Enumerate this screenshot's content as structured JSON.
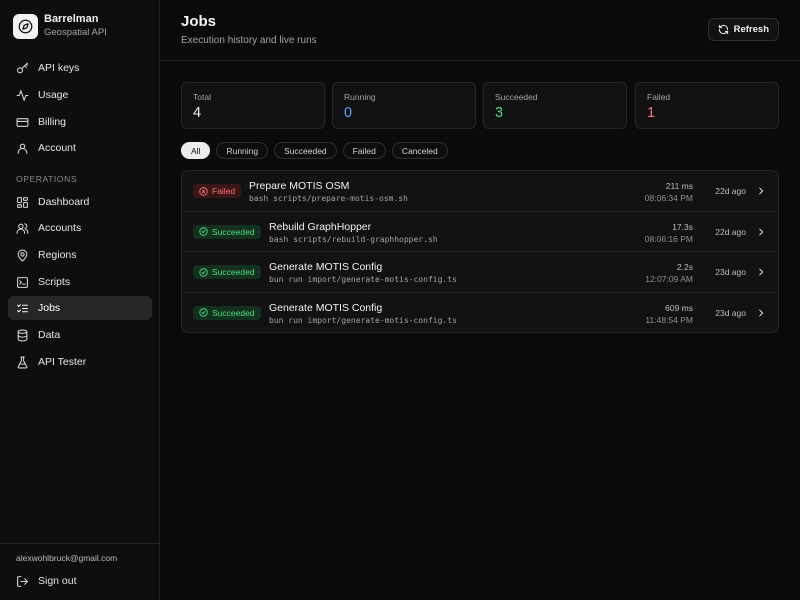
{
  "brand": {
    "name": "Barrelman",
    "subtitle": "Geospatial API",
    "logo_icon": "compass-icon"
  },
  "nav_top": [
    {
      "label": "API keys",
      "icon": "key-icon"
    },
    {
      "label": "Usage",
      "icon": "activity-icon"
    },
    {
      "label": "Billing",
      "icon": "credit-card-icon"
    },
    {
      "label": "Account",
      "icon": "user-icon"
    }
  ],
  "section_label": "OPERATIONS",
  "nav_ops": [
    {
      "label": "Dashboard",
      "icon": "dashboard-icon"
    },
    {
      "label": "Accounts",
      "icon": "users-icon"
    },
    {
      "label": "Regions",
      "icon": "map-pin-icon"
    },
    {
      "label": "Scripts",
      "icon": "terminal-icon"
    },
    {
      "label": "Jobs",
      "icon": "list-checks-icon",
      "active": true
    },
    {
      "label": "Data",
      "icon": "database-icon"
    },
    {
      "label": "API Tester",
      "icon": "flask-icon"
    }
  ],
  "user": {
    "email": "alexwohlbruck@gmail.com",
    "sign_out": "Sign out"
  },
  "header": {
    "title": "Jobs",
    "subtitle": "Execution history and live runs",
    "refresh_label": "Refresh"
  },
  "stats": [
    {
      "label": "Total",
      "value": "4",
      "color": "#f5f5f5"
    },
    {
      "label": "Running",
      "value": "0",
      "color": "#60a5fa"
    },
    {
      "label": "Succeeded",
      "value": "3",
      "color": "#4ade80"
    },
    {
      "label": "Failed",
      "value": "1",
      "color": "#f87171"
    }
  ],
  "filters": [
    "All",
    "Running",
    "Succeeded",
    "Failed",
    "Canceled"
  ],
  "active_filter": "All",
  "jobs": [
    {
      "status": "Failed",
      "name": "Prepare MOTIS OSM",
      "command": "bash scripts/prepare-motis-osm.sh",
      "duration": "211 ms",
      "time": "08:06:34 PM",
      "ago": "22d ago"
    },
    {
      "status": "Succeeded",
      "name": "Rebuild GraphHopper",
      "command": "bash scripts/rebuild-graphhopper.sh",
      "duration": "17.3s",
      "time": "08:06:16 PM",
      "ago": "22d ago"
    },
    {
      "status": "Succeeded",
      "name": "Generate MOTIS Config",
      "command": "bun run import/generate-motis-config.ts",
      "duration": "2.2s",
      "time": "12:07:09 AM",
      "ago": "23d ago"
    },
    {
      "status": "Succeeded",
      "name": "Generate MOTIS Config",
      "command": "bun run import/generate-motis-config.ts",
      "duration": "609 ms",
      "time": "11:48:54 PM",
      "ago": "23d ago"
    }
  ]
}
